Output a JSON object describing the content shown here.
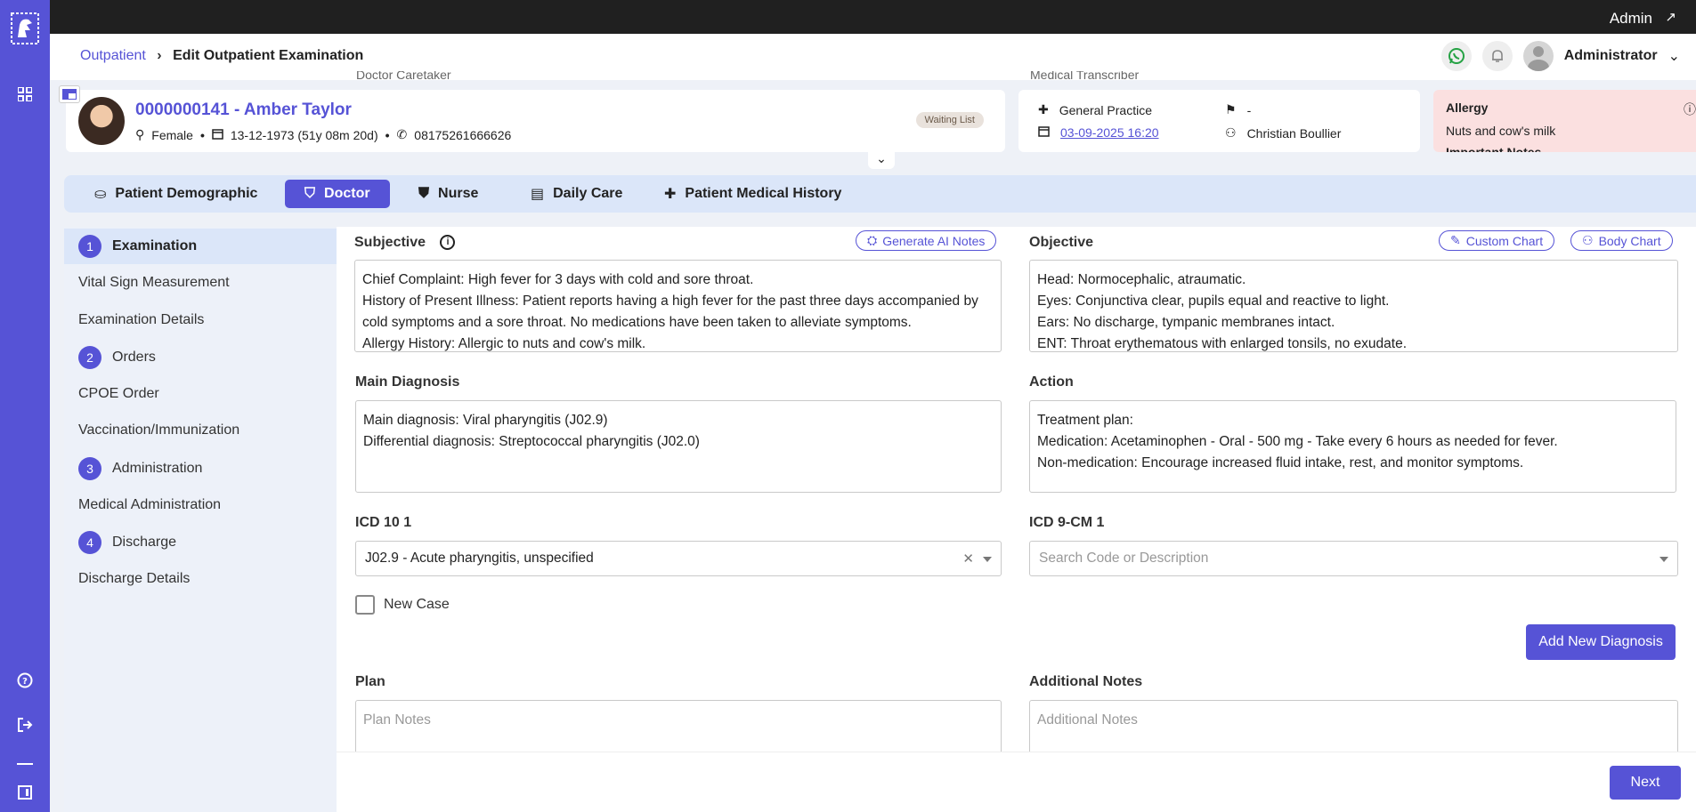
{
  "topbar": {
    "user": "Admin"
  },
  "header": {
    "breadcrumb": {
      "parent": "Outpatient",
      "current": "Edit Outpatient Examination"
    },
    "user_name": "Administrator"
  },
  "patient": {
    "id_name": "0000000141 - Amber Taylor",
    "gender": "Female",
    "dob": "13-12-1973 (51y 08m 20d)",
    "phone": "08175261666626",
    "status_badge": "Waiting List",
    "cut_label_left": "Doctor Caretaker",
    "cut_label_right": "Medical Transcriber"
  },
  "visit": {
    "department": "General Practice",
    "date": "03-09-2025 16:20",
    "flag_value": "-",
    "doctor": "Christian Boullier"
  },
  "allergy": {
    "title": "Allergy",
    "value": "Nuts and cow's milk",
    "next": "Important Notes"
  },
  "tabs": [
    {
      "label": "Patient Demographic",
      "icon": "patient-icon"
    },
    {
      "label": "Doctor",
      "icon": "doctor-icon"
    },
    {
      "label": "Nurse",
      "icon": "nurse-icon"
    },
    {
      "label": "Daily Care",
      "icon": "clipboard-icon"
    },
    {
      "label": "Patient Medical History",
      "icon": "medical-cross-icon"
    }
  ],
  "stepper": {
    "steps": [
      {
        "num": "1",
        "label": "Examination"
      },
      {
        "num": "2",
        "label": "Orders"
      },
      {
        "num": "3",
        "label": "Administration"
      },
      {
        "num": "4",
        "label": "Discharge"
      }
    ],
    "subs": {
      "vital": "Vital Sign Measurement",
      "exam_details": "Examination Details",
      "cpoe": "CPOE Order",
      "vaccination": "Vaccination/Immunization",
      "med_admin": "Medical Administration",
      "discharge_details": "Discharge Details"
    }
  },
  "form": {
    "subjective_label": "Subjective",
    "generate_ai": "Generate AI Notes",
    "subjective_lines": [
      "Chief Complaint: High fever for 3 days with cold and sore throat.",
      "History of Present Illness: Patient reports having a high fever for the past three days accompanied by",
      "cold symptoms and a sore throat. No medications have been taken to alleviate symptoms.",
      "Allergy History: Allergic to nuts and cow's milk."
    ],
    "objective_label": "Objective",
    "custom_chart": "Custom Chart",
    "body_chart": "Body Chart",
    "objective_lines": [
      "Head: Normocephalic, atraumatic.",
      "Eyes: Conjunctiva clear, pupils equal and reactive to light.",
      "Ears: No discharge, tympanic membranes intact.",
      "ENT: Throat erythematous with enlarged tonsils, no exudate."
    ],
    "main_diagnosis_label": "Main Diagnosis",
    "main_diagnosis_lines": [
      "Main diagnosis: Viral pharyngitis (J02.9)",
      "Differential diagnosis: Streptococcal pharyngitis (J02.0)"
    ],
    "action_label": "Action",
    "action_lines": [
      "Treatment plan:",
      "Medication: Acetaminophen - Oral - 500 mg - Take every 6 hours as needed for fever.",
      "Non-medication: Encourage increased fluid intake, rest, and monitor symptoms."
    ],
    "icd10_label": "ICD 10 1",
    "icd10_value": "J02.9 - Acute pharyngitis, unspecified",
    "icd9_label": "ICD 9-CM 1",
    "icd9_placeholder": "Search Code or Description",
    "new_case_label": "New Case",
    "add_diagnosis": "Add New Diagnosis",
    "plan_label": "Plan",
    "plan_placeholder": "Plan Notes",
    "notes_label": "Additional Notes",
    "notes_placeholder": "Additional Notes",
    "next": "Next"
  },
  "colors": {
    "primary": "#5653d6",
    "allergy_bg": "#fbe0e0",
    "tab_bg": "#dbe6f9"
  }
}
